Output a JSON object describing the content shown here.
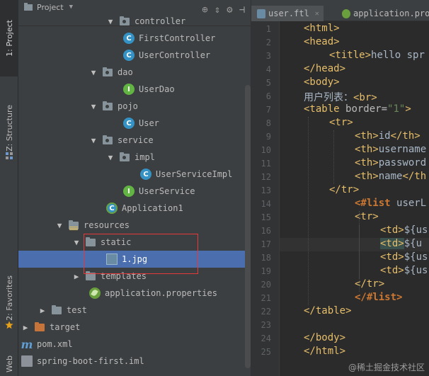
{
  "toolstrip": {
    "tabs": [
      {
        "id": "project",
        "label": "1: Project"
      },
      {
        "id": "structure",
        "label": "Z: Structure"
      },
      {
        "id": "favorites",
        "label": "2: Favorites"
      },
      {
        "id": "web",
        "label": "Web"
      }
    ]
  },
  "project_panel": {
    "title": "Project",
    "toolbar_icons": [
      "target-icon",
      "collapse-icon",
      "gear-icon",
      "hide-icon"
    ],
    "tree": [
      {
        "label": "controller",
        "icon": "folder-package",
        "depth": 5,
        "arrow": "down"
      },
      {
        "label": "FirstController",
        "icon": "class",
        "depth": 6,
        "arrow": ""
      },
      {
        "label": "UserController",
        "icon": "class",
        "depth": 6,
        "arrow": ""
      },
      {
        "label": "dao",
        "icon": "folder-package",
        "depth": 4,
        "arrow": "down"
      },
      {
        "label": "UserDao",
        "icon": "interface",
        "depth": 6,
        "arrow": ""
      },
      {
        "label": "pojo",
        "icon": "folder-package",
        "depth": 4,
        "arrow": "down"
      },
      {
        "label": "User",
        "icon": "class",
        "depth": 6,
        "arrow": ""
      },
      {
        "label": "service",
        "icon": "folder-package",
        "depth": 4,
        "arrow": "down"
      },
      {
        "label": "impl",
        "icon": "folder-package",
        "depth": 5,
        "arrow": "down"
      },
      {
        "label": "UserServiceImpl",
        "icon": "class",
        "depth": 7,
        "arrow": ""
      },
      {
        "label": "UserService",
        "icon": "interface",
        "depth": 6,
        "arrow": ""
      },
      {
        "label": "Application1",
        "icon": "spring-class",
        "depth": 5,
        "arrow": ""
      },
      {
        "label": "resources",
        "icon": "folder-resources",
        "depth": 2,
        "arrow": "down"
      },
      {
        "label": "static",
        "icon": "folder",
        "depth": 3,
        "arrow": "down"
      },
      {
        "label": "1.jpg",
        "icon": "image",
        "depth": 5,
        "arrow": "",
        "selected": true
      },
      {
        "label": "templates",
        "icon": "folder",
        "depth": 3,
        "arrow": "right"
      },
      {
        "label": "application.properties",
        "icon": "spring-leaf",
        "depth": 4,
        "arrow": ""
      },
      {
        "label": "test",
        "icon": "folder",
        "depth": 1,
        "arrow": "right"
      },
      {
        "label": "target",
        "icon": "folder-orange",
        "depth": 0,
        "arrow": "right"
      },
      {
        "label": "pom.xml",
        "icon": "maven",
        "depth": 0,
        "arrow": ""
      },
      {
        "label": "spring-boot-first.iml",
        "icon": "file",
        "depth": 0,
        "arrow": ""
      }
    ]
  },
  "editor": {
    "tabs": [
      {
        "label": "user.ftl",
        "active": true,
        "icon_color": "#6a8ba4"
      },
      {
        "label": "application.prop",
        "active": false,
        "icon_color": "#6a9f3d"
      }
    ],
    "line_numbers": [
      "1",
      "2",
      "3",
      "4",
      "5",
      "6",
      "7",
      "8",
      "9",
      "10",
      "11",
      "12",
      "13",
      "14",
      "15",
      "16",
      "17",
      "18",
      "19",
      "20",
      "21",
      "22",
      "23",
      "24",
      "25"
    ],
    "current_line": 17,
    "lines": [
      {
        "indent": 0,
        "tokens": [
          [
            "tag",
            "<html>"
          ]
        ]
      },
      {
        "indent": 0,
        "tokens": [
          [
            "tag",
            "<head>"
          ]
        ]
      },
      {
        "indent": 1,
        "tokens": [
          [
            "tag",
            "<title>"
          ],
          [
            "txt",
            "hello spr"
          ]
        ]
      },
      {
        "indent": 0,
        "tokens": [
          [
            "tag",
            "</head>"
          ]
        ]
      },
      {
        "indent": 0,
        "tokens": [
          [
            "tag",
            "<body>"
          ]
        ]
      },
      {
        "indent": 0,
        "tokens": [
          [
            "txt",
            "用户列表："
          ],
          [
            "tag",
            "<br>"
          ]
        ]
      },
      {
        "indent": 0,
        "tokens": [
          [
            "tag",
            "<table "
          ],
          [
            "attr",
            "border="
          ],
          [
            "str",
            "\"1\""
          ],
          [
            "tag",
            ">"
          ]
        ]
      },
      {
        "indent": 1,
        "tokens": [
          [
            "tag",
            "<tr>"
          ]
        ]
      },
      {
        "indent": 2,
        "tokens": [
          [
            "tag",
            "<th>"
          ],
          [
            "txt",
            "id"
          ],
          [
            "tag",
            "</th>"
          ]
        ]
      },
      {
        "indent": 2,
        "tokens": [
          [
            "tag",
            "<th>"
          ],
          [
            "txt",
            "username"
          ]
        ]
      },
      {
        "indent": 2,
        "tokens": [
          [
            "tag",
            "<th>"
          ],
          [
            "txt",
            "password"
          ]
        ]
      },
      {
        "indent": 2,
        "tokens": [
          [
            "tag",
            "<th>"
          ],
          [
            "txt",
            "name"
          ],
          [
            "tag",
            "</th"
          ]
        ]
      },
      {
        "indent": 1,
        "tokens": [
          [
            "tag",
            "</tr>"
          ]
        ]
      },
      {
        "indent": 2,
        "tokens": [
          [
            "dir",
            "<#list "
          ],
          [
            "txt",
            "userL"
          ]
        ]
      },
      {
        "indent": 2,
        "tokens": [
          [
            "tag",
            "<tr>"
          ]
        ]
      },
      {
        "indent": 3,
        "tokens": [
          [
            "tag",
            "<td>"
          ],
          [
            "txt",
            "${us"
          ]
        ]
      },
      {
        "indent": 3,
        "tokens": [
          [
            "tagcur",
            "<td>"
          ],
          [
            "txt",
            "${u"
          ]
        ]
      },
      {
        "indent": 3,
        "tokens": [
          [
            "tag",
            "<td>"
          ],
          [
            "txt",
            "${us"
          ]
        ]
      },
      {
        "indent": 3,
        "tokens": [
          [
            "tag",
            "<td>"
          ],
          [
            "txt",
            "${us"
          ]
        ]
      },
      {
        "indent": 2,
        "tokens": [
          [
            "tag",
            "</tr>"
          ]
        ]
      },
      {
        "indent": 2,
        "tokens": [
          [
            "dir",
            "</#list>"
          ]
        ]
      },
      {
        "indent": 0,
        "tokens": [
          [
            "tag",
            "</table>"
          ]
        ]
      },
      {
        "indent": 0,
        "tokens": []
      },
      {
        "indent": 0,
        "tokens": [
          [
            "tag",
            "</body>"
          ]
        ]
      },
      {
        "indent": 0,
        "tokens": [
          [
            "tag",
            "</html>"
          ]
        ]
      }
    ]
  },
  "watermark": "@稀土掘金技术社区",
  "colors": {
    "panel_bg": "#3c3f41",
    "editor_bg": "#2b2b2b",
    "selection": "#4b6eaf",
    "highlight_box": "#e33a3a",
    "tag": "#e8bf6a",
    "directive": "#cc7832"
  }
}
